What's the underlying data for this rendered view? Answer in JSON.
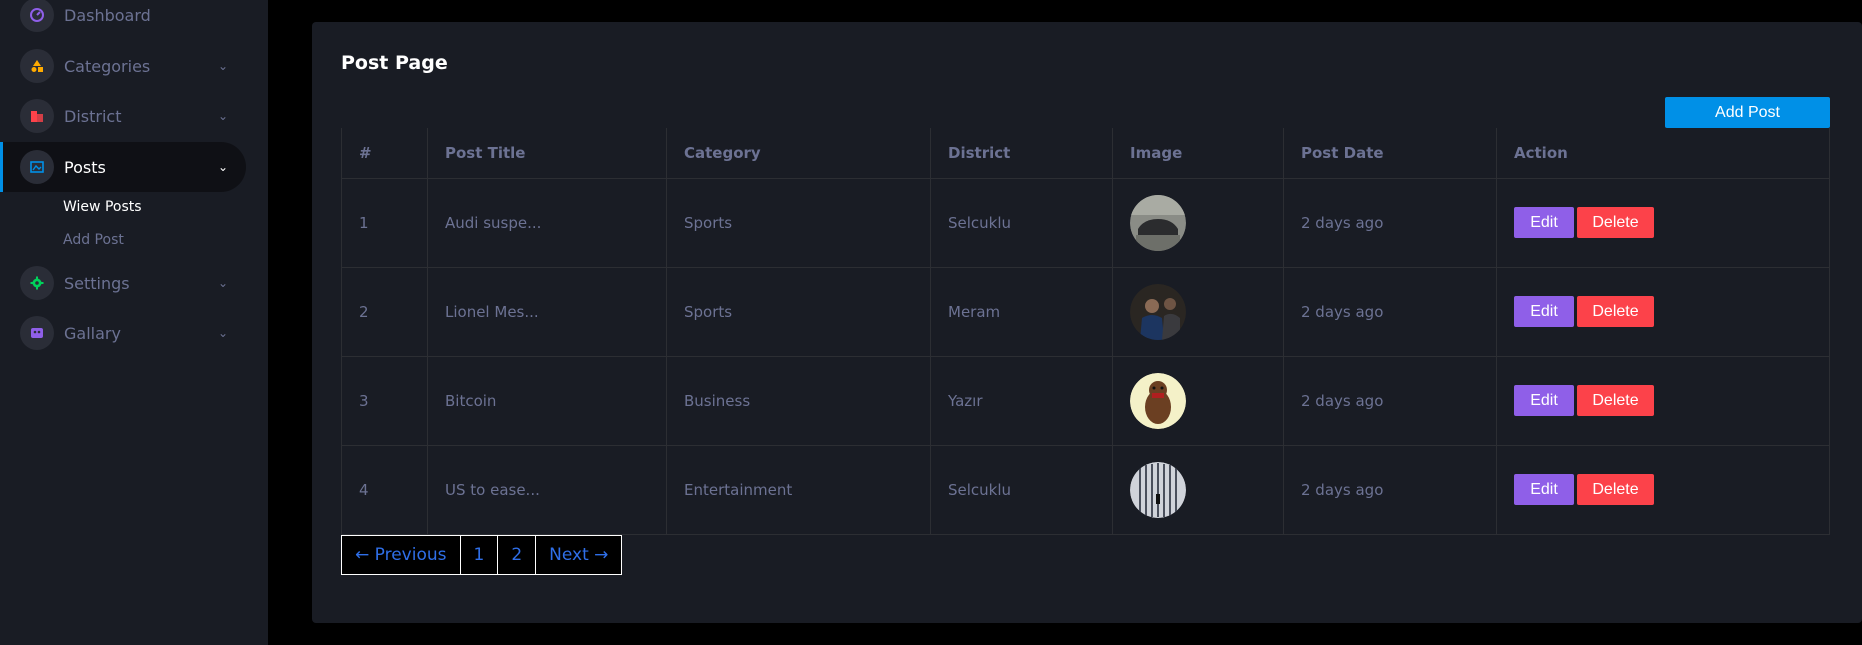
{
  "sidebar": {
    "items": [
      {
        "label": "Dashboard",
        "icon": "speedometer-icon",
        "color": "#8f5fe8"
      },
      {
        "label": "Categories",
        "icon": "shapes-icon",
        "color": "#ffab00"
      },
      {
        "label": "District",
        "icon": "building-icon",
        "color": "#fc424a"
      },
      {
        "label": "Posts",
        "icon": "image-icon",
        "color": "#0090e7"
      },
      {
        "label": "Settings",
        "icon": "gear-icon",
        "color": "#00d25b"
      },
      {
        "label": "Gallary",
        "icon": "gallery-icon",
        "color": "#8f5fe8"
      }
    ],
    "posts_sub": [
      "Wiew Posts",
      "Add Post"
    ]
  },
  "page": {
    "title": "Post Page",
    "add_button": "Add Post"
  },
  "table": {
    "headers": [
      "#",
      "Post Title",
      "Category",
      "District",
      "Image",
      "Post Date",
      "Action"
    ],
    "rows": [
      {
        "num": "1",
        "title": "Audi suspe...",
        "category": "Sports",
        "district": "Selcuklu",
        "date": "2 days ago"
      },
      {
        "num": "2",
        "title": "Lionel Mes...",
        "category": "Sports",
        "district": "Meram",
        "date": "2 days ago"
      },
      {
        "num": "3",
        "title": "Bitcoin",
        "category": "Business",
        "district": "Yazır",
        "date": "2 days ago"
      },
      {
        "num": "4",
        "title": "US to ease...",
        "category": "Entertainment",
        "district": "Selcuklu",
        "date": "2 days ago"
      }
    ],
    "edit_label": "Edit",
    "delete_label": "Delete"
  },
  "pagination": {
    "previous": "← Previous",
    "pages": [
      "1",
      "2"
    ],
    "next": "Next →"
  }
}
